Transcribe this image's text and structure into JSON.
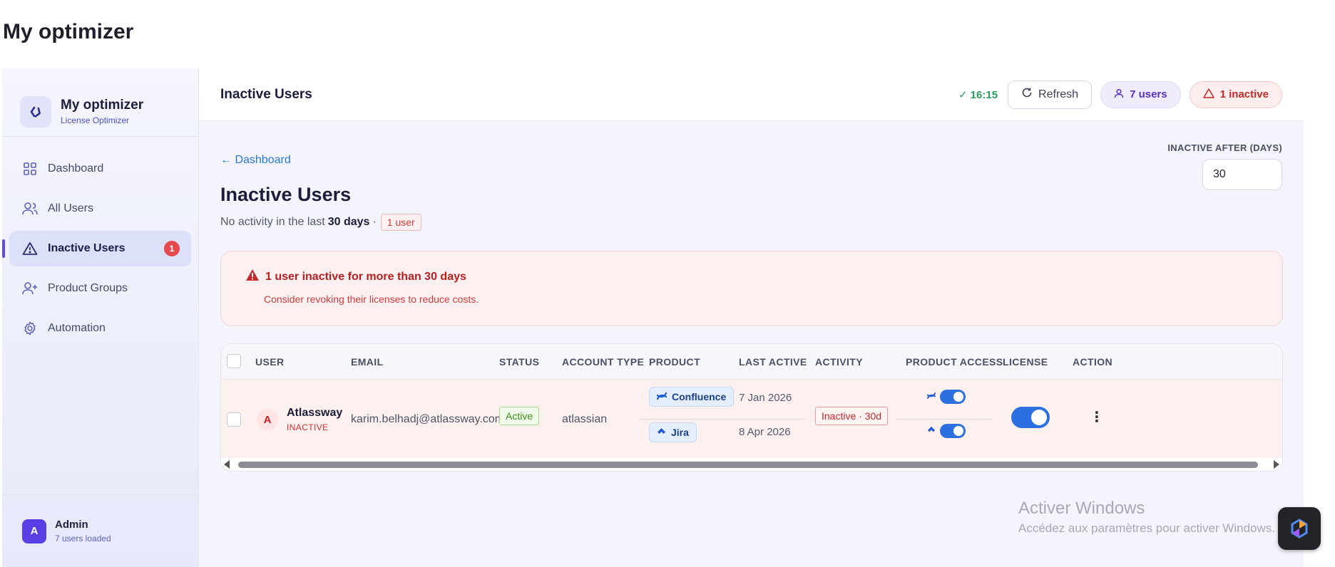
{
  "page": {
    "heading": "My optimizer"
  },
  "sidebar": {
    "brand": {
      "name": "My optimizer",
      "subtitle": "License Optimizer"
    },
    "items": [
      {
        "label": "Dashboard",
        "icon": "grid-icon"
      },
      {
        "label": "All Users",
        "icon": "users-icon"
      },
      {
        "label": "Inactive Users",
        "icon": "warning-icon",
        "badge": "1",
        "active": true
      },
      {
        "label": "Product Groups",
        "icon": "user-plus-icon"
      },
      {
        "label": "Automation",
        "icon": "gear-icon"
      }
    ],
    "footer": {
      "avatar": "A",
      "name": "Admin",
      "subtitle": "7 users loaded"
    }
  },
  "topbar": {
    "title": "Inactive Users",
    "sync_time": "✓ 16:15",
    "refresh_label": "Refresh",
    "users_pill": "7 users",
    "inactive_pill": "1 inactive"
  },
  "content": {
    "back_link": "← Dashboard",
    "threshold": {
      "label": "INACTIVE AFTER (DAYS)",
      "value": "30"
    },
    "title": "Inactive Users",
    "subline": {
      "prefix": "No activity in the last",
      "bold": "30 days",
      "sep": "·",
      "count": "1 user"
    },
    "alert": {
      "title": "1 user inactive for more than 30 days",
      "body": "Consider revoking their licenses to reduce costs."
    }
  },
  "table": {
    "columns": [
      "USER",
      "EMAIL",
      "STATUS",
      "ACCOUNT TYPE",
      "PRODUCT",
      "LAST ACTIVE",
      "ACTIVITY",
      "PRODUCT ACCESS",
      "LICENSE",
      "ACTION"
    ],
    "rows": [
      {
        "avatar": "A",
        "name": "Atlassway",
        "state": "INACTIVE",
        "email": "karim.belhadj@atlassway.com",
        "status": "Active",
        "account_type": "atlassian",
        "products": [
          {
            "name": "Confluence",
            "icon": "confluence-icon",
            "last_active": "7 Jan 2026",
            "access": true
          },
          {
            "name": "Jira",
            "icon": "jira-icon",
            "last_active": "8 Apr 2026",
            "access": true
          }
        ],
        "activity": "Inactive · 30d",
        "license": true
      }
    ]
  },
  "watermark": {
    "title": "Activer Windows",
    "subtitle": "Accédez aux paramètres pour activer Windows."
  },
  "colors": {
    "accent": "#5b4ee0",
    "danger": "#e5484d",
    "toggle": "#2b6fe0",
    "success": "#2a9b5f"
  }
}
